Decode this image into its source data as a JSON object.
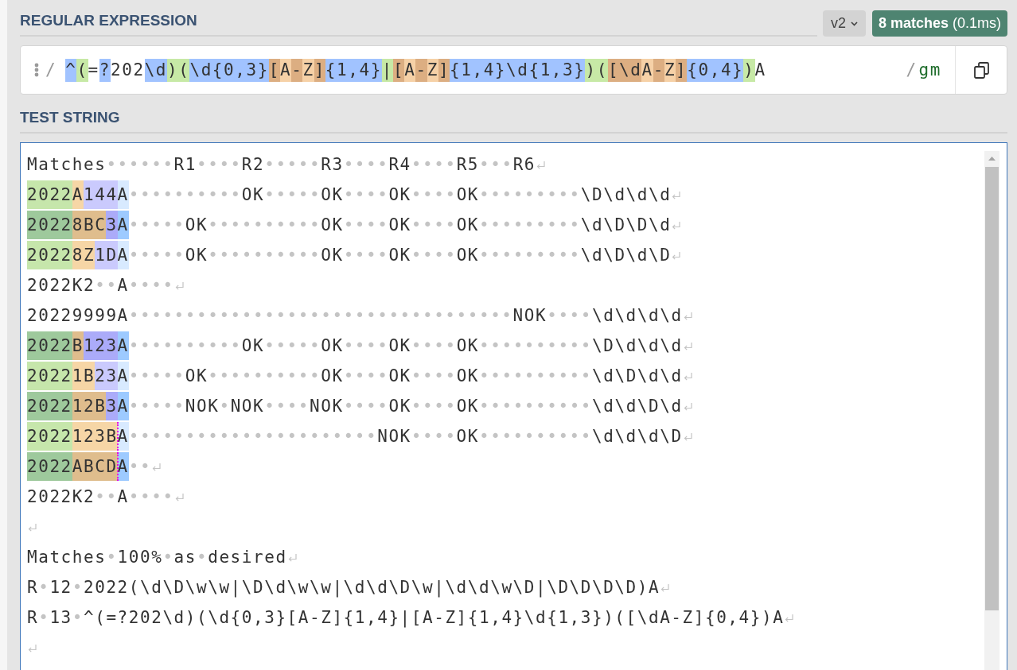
{
  "regex_panel": {
    "heading": "REGULAR EXPRESSION",
    "version_dropdown": {
      "label": "v2"
    },
    "match_badge": "**8 matches** (0.1ms)",
    "expression": {
      "open_delimiter": "/",
      "tokens": [
        {
          "kind": "meta",
          "text": "^"
        },
        {
          "kind": "group",
          "text": "("
        },
        {
          "kind": "literal",
          "text": "="
        },
        {
          "kind": "meta",
          "text": "?"
        },
        {
          "kind": "literal",
          "text": "202"
        },
        {
          "kind": "meta",
          "text": "\\d"
        },
        {
          "kind": "group",
          "text": ")("
        },
        {
          "kind": "meta",
          "text": "\\d{0,3}"
        },
        {
          "kind": "set",
          "text": "["
        },
        {
          "kind": "set-char",
          "text": "A"
        },
        {
          "kind": "set",
          "text": "-"
        },
        {
          "kind": "set-char",
          "text": "Z"
        },
        {
          "kind": "set",
          "text": "]"
        },
        {
          "kind": "meta",
          "text": "{1,4}"
        },
        {
          "kind": "alternation",
          "text": "|"
        },
        {
          "kind": "set",
          "text": "["
        },
        {
          "kind": "set-char",
          "text": "A"
        },
        {
          "kind": "set",
          "text": "-"
        },
        {
          "kind": "set-char",
          "text": "Z"
        },
        {
          "kind": "set",
          "text": "]"
        },
        {
          "kind": "meta",
          "text": "{1,4}\\d{1,3}"
        },
        {
          "kind": "group",
          "text": ")("
        },
        {
          "kind": "set",
          "text": "[\\d"
        },
        {
          "kind": "set-char",
          "text": "A"
        },
        {
          "kind": "set",
          "text": "-"
        },
        {
          "kind": "set-char",
          "text": "Z"
        },
        {
          "kind": "set",
          "text": "]"
        },
        {
          "kind": "meta",
          "text": "{0,4}"
        },
        {
          "kind": "group",
          "text": ")"
        },
        {
          "kind": "literal",
          "text": "A"
        }
      ],
      "close_delimiter": "/",
      "flags": "gm"
    }
  },
  "test_string": {
    "heading": "TEST STRING",
    "lines": [
      {
        "kind": "text",
        "text": "Matches••••••R1••••R2•••••R3••••R4••••R5•••R6"
      },
      {
        "kind": "match",
        "alternate": false,
        "parts": [
          {
            "kind": "group1",
            "text": "2022"
          },
          {
            "kind": "group2",
            "text": "A"
          },
          {
            "kind": "group3",
            "text": "144"
          },
          {
            "kind": "match",
            "text": "A"
          }
        ],
        "text": "••••••••••OK•••••OK••••OK••••OK•••••••••\\D\\d\\d\\d"
      },
      {
        "kind": "match",
        "alternate": true,
        "parts": [
          {
            "kind": "group1",
            "text": "2022"
          },
          {
            "kind": "group2",
            "text": "8BC"
          },
          {
            "kind": "group3",
            "text": "3"
          },
          {
            "kind": "match",
            "text": "A"
          }
        ],
        "text": "•••••OK••••••••••OK••••OK••••OK•••••••••\\d\\D\\D\\d"
      },
      {
        "kind": "match",
        "alternate": false,
        "parts": [
          {
            "kind": "group1",
            "text": "2022"
          },
          {
            "kind": "group2",
            "text": "8Z"
          },
          {
            "kind": "group3",
            "text": "1D"
          },
          {
            "kind": "match",
            "text": "A"
          }
        ],
        "text": "•••••OK••••••••••OK••••OK••••OK•••••••••\\d\\D\\d\\D"
      },
      {
        "kind": "text",
        "text": "2022K2••A••••"
      },
      {
        "kind": "text",
        "text": "20229999A••••••••••••••••••••••••••••••••••NOK••••\\d\\d\\d\\d"
      },
      {
        "kind": "match",
        "alternate": true,
        "parts": [
          {
            "kind": "group1",
            "text": "2022"
          },
          {
            "kind": "group2",
            "text": "B"
          },
          {
            "kind": "group3",
            "text": "123"
          },
          {
            "kind": "match",
            "text": "A"
          }
        ],
        "text": "••••••••••OK•••••OK••••OK••••OK••••••••••\\D\\d\\d\\d"
      },
      {
        "kind": "match",
        "alternate": false,
        "parts": [
          {
            "kind": "group1",
            "text": "2022"
          },
          {
            "kind": "group2",
            "text": "1B"
          },
          {
            "kind": "group3",
            "text": "23"
          },
          {
            "kind": "match",
            "text": "A"
          }
        ],
        "text": "•••••OK••••••••••OK••••OK••••OK••••••••••\\d\\D\\d\\d"
      },
      {
        "kind": "match",
        "alternate": true,
        "parts": [
          {
            "kind": "group1",
            "text": "2022"
          },
          {
            "kind": "group2",
            "text": "12B"
          },
          {
            "kind": "group3",
            "text": "3"
          },
          {
            "kind": "match",
            "text": "A"
          }
        ],
        "text": "•••••NOK•NOK••••NOK••••OK••••OK••••••••••\\d\\d\\D\\d"
      },
      {
        "kind": "match",
        "alternate": false,
        "parts": [
          {
            "kind": "group1",
            "text": "2022"
          },
          {
            "kind": "group2",
            "text": "123B"
          },
          {
            "kind": "empty-group"
          },
          {
            "kind": "match",
            "text": "A"
          }
        ],
        "text": "••••••••••••••••••••••NOK••••OK••••••••••\\d\\d\\d\\D"
      },
      {
        "kind": "match",
        "alternate": true,
        "parts": [
          {
            "kind": "group1",
            "text": "2022"
          },
          {
            "kind": "group2",
            "text": "ABCD"
          },
          {
            "kind": "empty-group"
          },
          {
            "kind": "match",
            "text": "A"
          }
        ],
        "text": "••"
      },
      {
        "kind": "text",
        "text": "2022K2••A••••"
      },
      {
        "kind": "blank"
      },
      {
        "kind": "text",
        "text": "Matches•100%•as•desired"
      },
      {
        "kind": "text",
        "text": "R•12•2022(\\d\\D\\w\\w|\\D\\d\\w\\w|\\d\\d\\D\\w|\\d\\d\\w\\D|\\D\\D\\D\\D)A"
      },
      {
        "kind": "text",
        "text": "R•13•^(=?202\\d)(\\d{0,3}[A-Z]{1,4}|[A-Z]{1,4}\\d{1,3})([\\dA-Z]{0,4})A"
      },
      {
        "kind": "blank"
      }
    ]
  }
}
